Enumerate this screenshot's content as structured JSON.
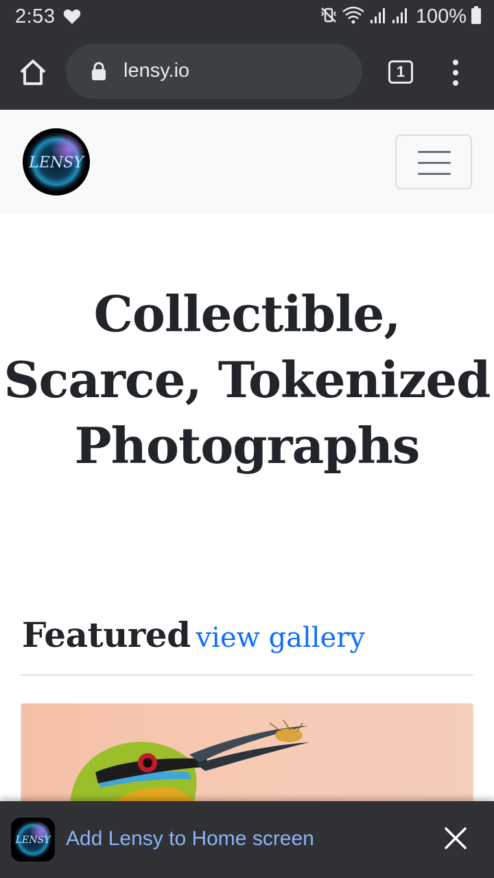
{
  "status_bar": {
    "time": "2:53",
    "battery": "100%",
    "icons": [
      "heart-icon",
      "mute-vibrate-icon",
      "wifi-icon",
      "signal-icon",
      "signal-icon",
      "battery-icon"
    ]
  },
  "browser": {
    "url": "lensy.io",
    "tab_count": "1",
    "icons": [
      "home-icon",
      "lock-icon",
      "tabs-icon",
      "more-vert-icon"
    ]
  },
  "navbar": {
    "logo_text": "LENSY",
    "icons": [
      "hamburger-menu-icon"
    ]
  },
  "hero": {
    "line1": "Collectible,",
    "line2": "Scarce, Tokenized",
    "line3": "Photographs"
  },
  "featured": {
    "title": "Featured",
    "link": "view gallery"
  },
  "banner": {
    "text": "Add Lensy to Home screen",
    "icons": [
      "close-icon"
    ]
  },
  "colors": {
    "chrome_dark": "#303134",
    "omnibox": "#3c4043",
    "navbar_bg": "#f8f9fa",
    "heading_text": "#212529",
    "link_blue": "#0d6efd",
    "banner_link": "#8ab4f8"
  }
}
